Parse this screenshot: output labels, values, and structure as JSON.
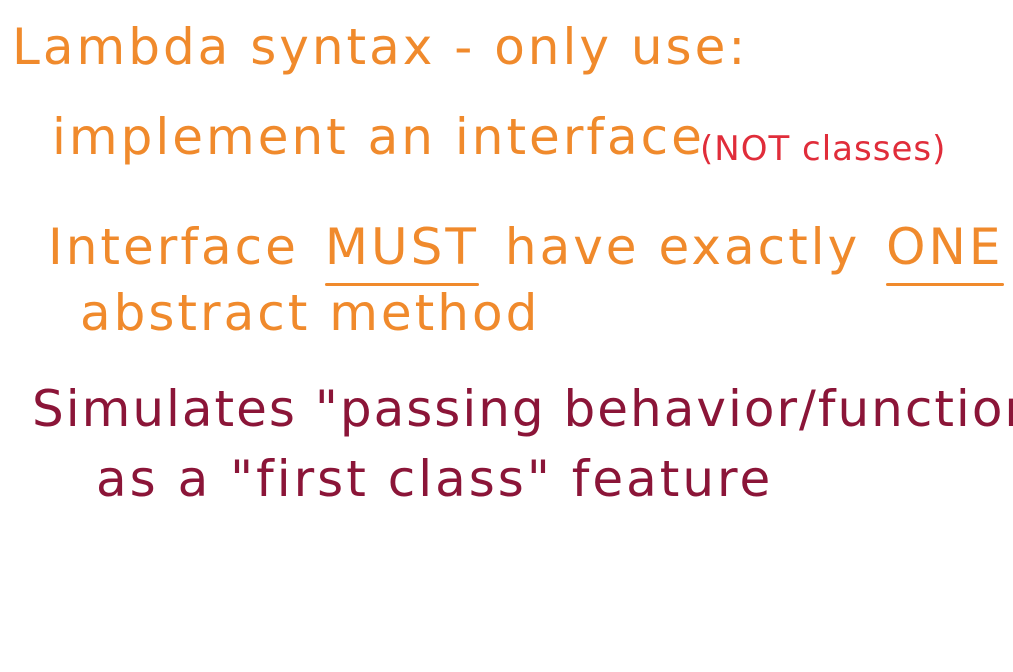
{
  "notes": {
    "line1": "Lambda syntax - only use:",
    "line2": "implement an interface",
    "line2_note": "(NOT classes)",
    "line3_a": "Interface",
    "line3_must": "MUST",
    "line3_b": "have exactly",
    "line3_one": "ONE",
    "line4": "abstract method",
    "line5": "Simulates \"passing behavior/function\"",
    "line6": "as a \"first class\" feature"
  },
  "colors": {
    "orange": "#f08a2c",
    "red": "#e02d3a",
    "maroon": "#8b1538"
  }
}
